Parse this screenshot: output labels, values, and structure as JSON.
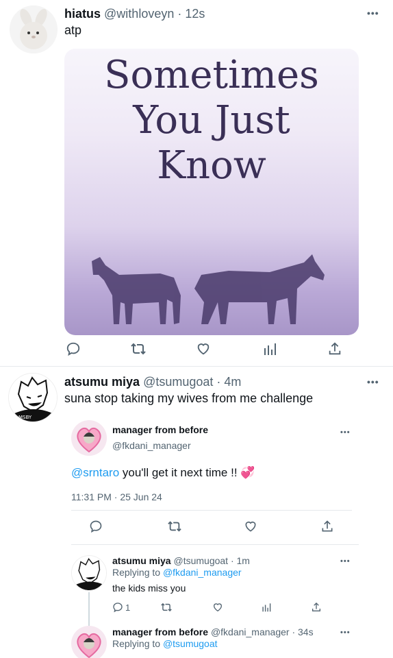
{
  "tweets": [
    {
      "name": "hiatus",
      "handle": "@withloveyn",
      "time": "· 12s",
      "text": "atp",
      "media": {
        "title_lines": [
          "Sometimes",
          "You Just",
          "Know"
        ]
      },
      "avatar_icon": "bunny-plush-avatar"
    },
    {
      "name": "atsumu miya",
      "handle": "@tsumugoat",
      "time": "· 4m",
      "text": "suna stop taking my wives from me challenge",
      "avatar_icon": "manga-character-avatar"
    }
  ],
  "quoted": {
    "name": "manager from before",
    "handle": "@fkdani_manager",
    "mention": "@srntaro",
    "text": " you'll get it next time !! ",
    "emoji": "💞",
    "timestamp": "11:31 PM · 25 Jun 24"
  },
  "replies": [
    {
      "name": "atsumu miya",
      "handle_time": "@tsumugoat · 1m",
      "replying_prefix": "Replying to ",
      "replying_to": "@fkdani_manager",
      "text": "the kids miss you",
      "reply_count": "1"
    },
    {
      "name": "manager from before",
      "handle_time": "@fkdani_manager · 34s",
      "replying_prefix": "Replying to ",
      "replying_to": "@tsumugoat"
    }
  ],
  "colors": {
    "link": "#1d9bf0",
    "muted": "#536471",
    "emoji_heart": "#e04fa0"
  }
}
